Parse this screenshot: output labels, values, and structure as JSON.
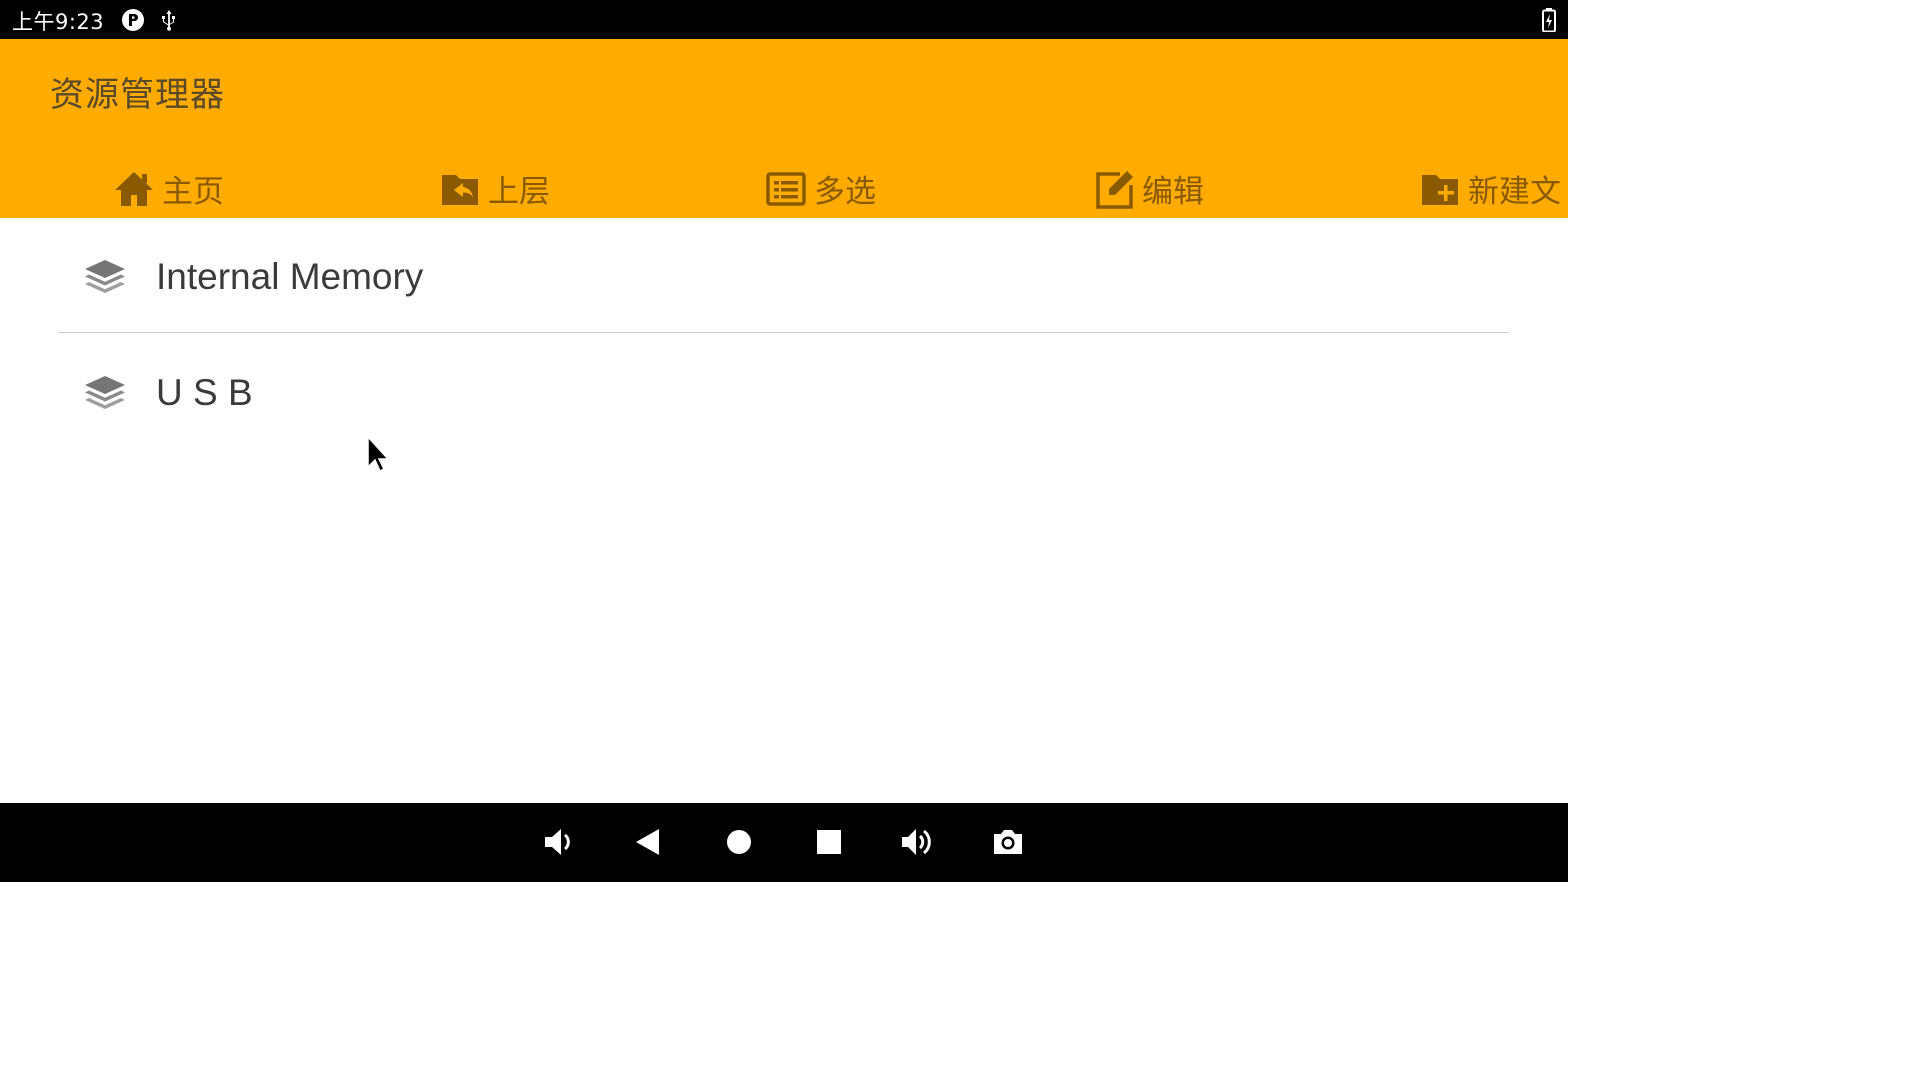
{
  "status_bar": {
    "time": "上午9:23",
    "icons": [
      "p-badge-icon",
      "usb-icon"
    ],
    "battery_icon": "battery-charging-icon"
  },
  "app_bar": {
    "title": "资源管理器",
    "color": "#FFAB00",
    "toolbar": [
      {
        "name": "home",
        "label": "主页",
        "icon": "home-icon"
      },
      {
        "name": "up",
        "label": "上层",
        "icon": "folder-back-icon"
      },
      {
        "name": "multiselect",
        "label": "多选",
        "icon": "checklist-icon"
      },
      {
        "name": "edit",
        "label": "编辑",
        "icon": "edit-icon"
      },
      {
        "name": "new-folder",
        "label": "新建文",
        "icon": "folder-add-icon"
      }
    ]
  },
  "storage_list": [
    {
      "label": "Internal Memory",
      "icon": "layers-icon"
    },
    {
      "label": "U S B",
      "icon": "layers-icon"
    }
  ],
  "nav_bar": {
    "buttons": [
      "volume-down-icon",
      "back-icon",
      "home-circle-icon",
      "recents-icon",
      "volume-up-icon",
      "camera-icon"
    ]
  }
}
